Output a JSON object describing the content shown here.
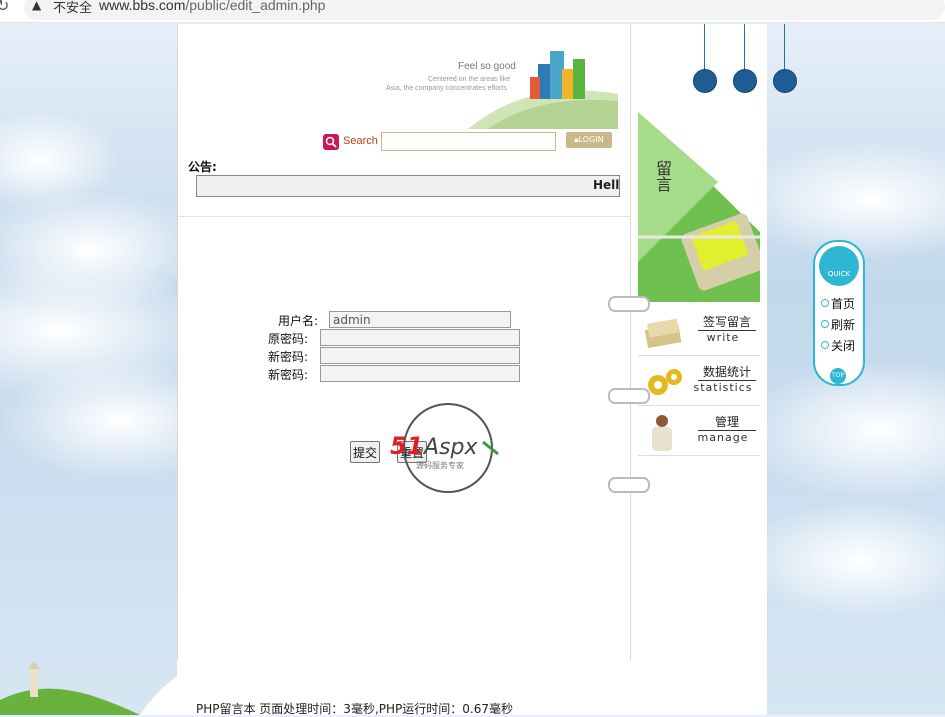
{
  "browser": {
    "security_label": "不安全",
    "url_host": "www.bbs.com",
    "url_path": "/public/edit_admin.php"
  },
  "header": {
    "slogan": "Feel so good",
    "tagline_1": "Centered on the areas like",
    "tagline_2": "Asia, the company concentrates efforts"
  },
  "search": {
    "label": "Search",
    "value": "",
    "login_label": "LOGIN"
  },
  "notice": {
    "label": "公告:",
    "text": "Hello"
  },
  "form": {
    "username_label": "用户名:",
    "username_value": "admin",
    "old_password_label": "原密码:",
    "new_password_label": "新密码:",
    "confirm_password_label": "新密码:",
    "submit_label": "提交",
    "reset_label": "重置"
  },
  "watermark": {
    "brand_51": "51",
    "brand_aspx": "Aspx",
    "sub": "源码服务专家"
  },
  "sidebar": {
    "leaf_text": "留言",
    "items": [
      {
        "cn": "签写留言",
        "en": "write"
      },
      {
        "cn": "数据统计",
        "en": "statistics"
      },
      {
        "cn": "管理",
        "en": "manage"
      }
    ]
  },
  "quick_menu": {
    "title_1": "QUICK",
    "title_2": "MENU",
    "items": [
      "首页",
      "刷新",
      "关闭"
    ],
    "top_label": "TOP"
  },
  "footer": {
    "text": "PHP留言本  页面处理时间：3毫秒,PHP运行时间：0.67毫秒"
  },
  "colors": {
    "accent_blue": "#2fb6d3",
    "pin_blue": "#1f5c94",
    "search_red": "#c8185a",
    "leaf_green": "#5fb84a"
  }
}
